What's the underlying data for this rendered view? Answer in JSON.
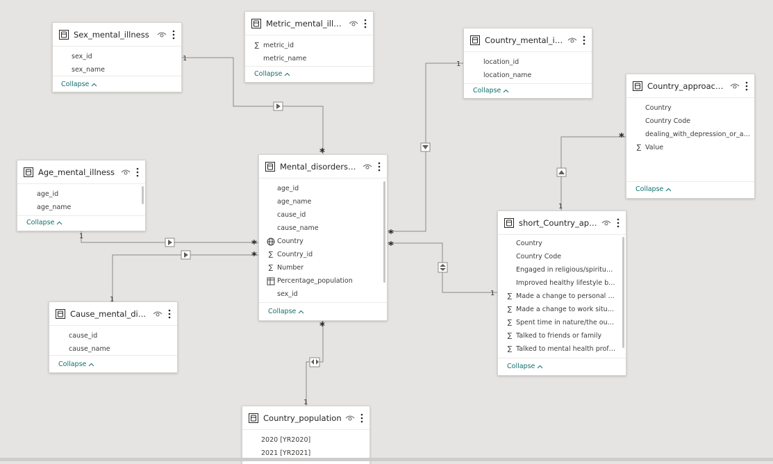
{
  "tables": {
    "sex": {
      "title": "Sex_mental_illness",
      "fields": [
        "sex_id",
        "sex_name"
      ],
      "collapse": "Collapse"
    },
    "metric": {
      "title": "Metric_mental_illness",
      "fields": [
        "metric_id",
        "metric_name"
      ],
      "collapse": "Collapse"
    },
    "country": {
      "title": "Country_mental_illness",
      "fields": [
        "location_id",
        "location_name"
      ],
      "collapse": "Collapse"
    },
    "approach": {
      "title": "Country_approach_de...",
      "fields": [
        "Country",
        "Country Code",
        "dealing_with_depression_or_anx...",
        "Value"
      ],
      "collapse": "Collapse"
    },
    "age": {
      "title": "Age_mental_illness",
      "fields": [
        "age_id",
        "age_name"
      ],
      "collapse": "Collapse"
    },
    "main": {
      "title": "Mental_disorders_val...",
      "fields": [
        "age_id",
        "age_name",
        "cause_id",
        "cause_name",
        "Country",
        "Country_id",
        "Number",
        "Percentage_population",
        "sex_id"
      ],
      "collapse": "Collapse"
    },
    "short": {
      "title": "short_Country_appro...",
      "fields": [
        "Country",
        "Country Code",
        "Engaged in religious/spiritual a...",
        "Improved healthy lifestyle beha...",
        "Made a change to personal rel...",
        "Made a change to work situation",
        "Spent time in nature/the outdo...",
        "Talked to friends or family",
        "Talked to mental health profess..."
      ],
      "collapse": "Collapse"
    },
    "cause": {
      "title": "Cause_mental_disorder",
      "fields": [
        "cause_id",
        "cause_name"
      ],
      "collapse": "Collapse"
    },
    "population": {
      "title": "Country_population",
      "fields": [
        "2020 [YR2020]",
        "2021 [YR2021]"
      ]
    }
  },
  "cardinality": {
    "one": "1",
    "many": "*"
  }
}
